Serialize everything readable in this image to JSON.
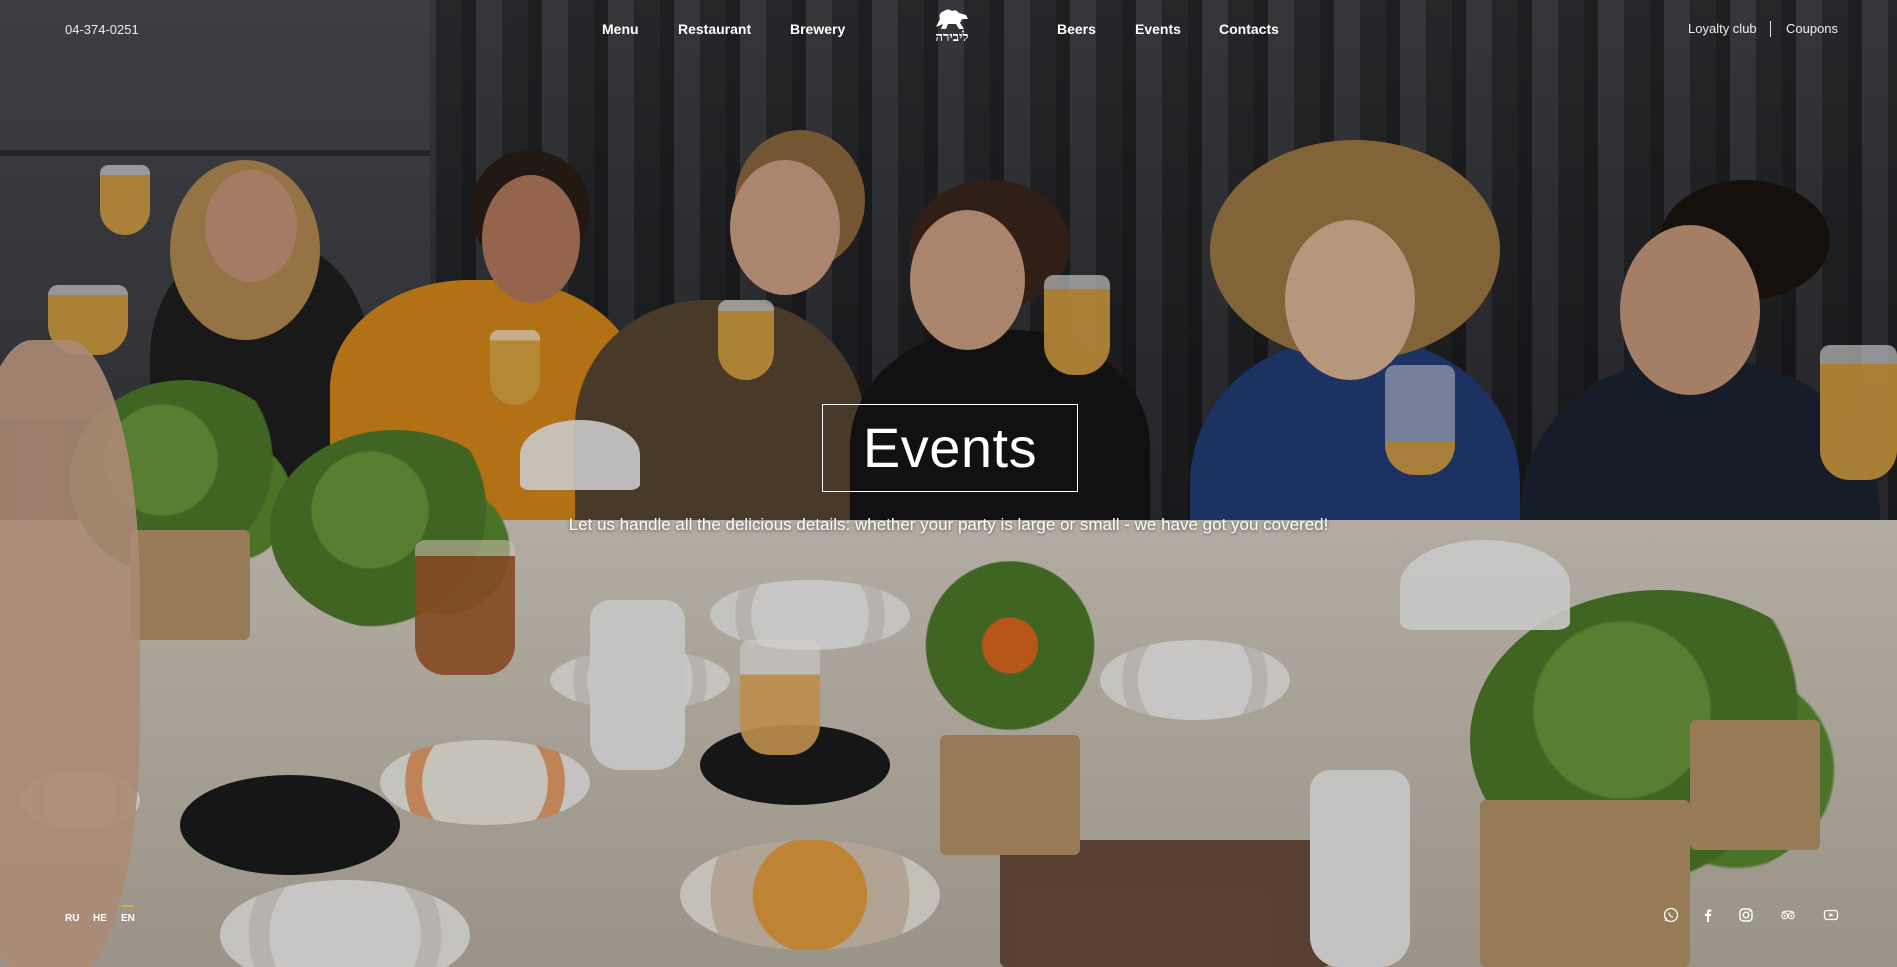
{
  "header": {
    "phone": "04-374-0251",
    "nav_left": [
      {
        "label": "Menu"
      },
      {
        "label": "Restaurant"
      },
      {
        "label": "Brewery"
      }
    ],
    "logo_text": "ליבירה",
    "nav_right": [
      {
        "label": "Beers"
      },
      {
        "label": "Events"
      },
      {
        "label": "Contacts"
      }
    ],
    "loyalty_label": "Loyalty club",
    "coupons_label": "Coupons"
  },
  "hero": {
    "title": "Events",
    "subtitle": "Let us handle all the delicious details: whether your party is large or small - we have got you covered!"
  },
  "languages": [
    {
      "label": "RU",
      "active": false
    },
    {
      "label": "HE",
      "active": false
    },
    {
      "label": "EN",
      "active": true
    }
  ],
  "social": [
    "whatsapp-icon",
    "facebook-icon",
    "instagram-icon",
    "tripadvisor-icon",
    "youtube-icon"
  ],
  "colors": {
    "accent": "#e0a844",
    "text": "#ffffff"
  }
}
